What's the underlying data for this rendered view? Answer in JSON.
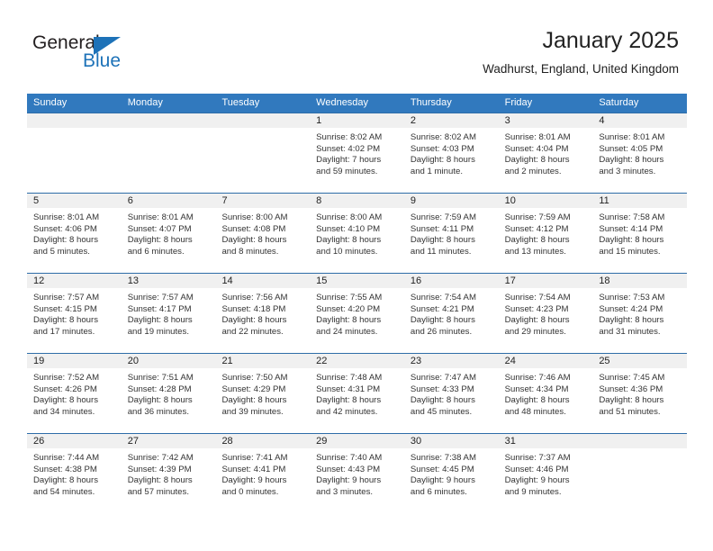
{
  "brand": {
    "name_part1": "General",
    "name_part2": "Blue",
    "logo_icon": "flag-triangle-icon",
    "accent_color": "#1d72b8"
  },
  "header": {
    "title": "January 2025",
    "subtitle": "Wadhurst, England, United Kingdom"
  },
  "theme": {
    "header_row_bg": "#3179be",
    "daynum_bg": "#f0f0f0",
    "grid_line": "#2e6da8"
  },
  "weekdays": [
    "Sunday",
    "Monday",
    "Tuesday",
    "Wednesday",
    "Thursday",
    "Friday",
    "Saturday"
  ],
  "weeks": [
    [
      {
        "day": "",
        "sunrise": "",
        "sunset": "",
        "daylight": "",
        "daylight2": ""
      },
      {
        "day": "",
        "sunrise": "",
        "sunset": "",
        "daylight": "",
        "daylight2": ""
      },
      {
        "day": "",
        "sunrise": "",
        "sunset": "",
        "daylight": "",
        "daylight2": ""
      },
      {
        "day": "1",
        "sunrise": "Sunrise: 8:02 AM",
        "sunset": "Sunset: 4:02 PM",
        "daylight": "Daylight: 7 hours",
        "daylight2": "and 59 minutes."
      },
      {
        "day": "2",
        "sunrise": "Sunrise: 8:02 AM",
        "sunset": "Sunset: 4:03 PM",
        "daylight": "Daylight: 8 hours",
        "daylight2": "and 1 minute."
      },
      {
        "day": "3",
        "sunrise": "Sunrise: 8:01 AM",
        "sunset": "Sunset: 4:04 PM",
        "daylight": "Daylight: 8 hours",
        "daylight2": "and 2 minutes."
      },
      {
        "day": "4",
        "sunrise": "Sunrise: 8:01 AM",
        "sunset": "Sunset: 4:05 PM",
        "daylight": "Daylight: 8 hours",
        "daylight2": "and 3 minutes."
      }
    ],
    [
      {
        "day": "5",
        "sunrise": "Sunrise: 8:01 AM",
        "sunset": "Sunset: 4:06 PM",
        "daylight": "Daylight: 8 hours",
        "daylight2": "and 5 minutes."
      },
      {
        "day": "6",
        "sunrise": "Sunrise: 8:01 AM",
        "sunset": "Sunset: 4:07 PM",
        "daylight": "Daylight: 8 hours",
        "daylight2": "and 6 minutes."
      },
      {
        "day": "7",
        "sunrise": "Sunrise: 8:00 AM",
        "sunset": "Sunset: 4:08 PM",
        "daylight": "Daylight: 8 hours",
        "daylight2": "and 8 minutes."
      },
      {
        "day": "8",
        "sunrise": "Sunrise: 8:00 AM",
        "sunset": "Sunset: 4:10 PM",
        "daylight": "Daylight: 8 hours",
        "daylight2": "and 10 minutes."
      },
      {
        "day": "9",
        "sunrise": "Sunrise: 7:59 AM",
        "sunset": "Sunset: 4:11 PM",
        "daylight": "Daylight: 8 hours",
        "daylight2": "and 11 minutes."
      },
      {
        "day": "10",
        "sunrise": "Sunrise: 7:59 AM",
        "sunset": "Sunset: 4:12 PM",
        "daylight": "Daylight: 8 hours",
        "daylight2": "and 13 minutes."
      },
      {
        "day": "11",
        "sunrise": "Sunrise: 7:58 AM",
        "sunset": "Sunset: 4:14 PM",
        "daylight": "Daylight: 8 hours",
        "daylight2": "and 15 minutes."
      }
    ],
    [
      {
        "day": "12",
        "sunrise": "Sunrise: 7:57 AM",
        "sunset": "Sunset: 4:15 PM",
        "daylight": "Daylight: 8 hours",
        "daylight2": "and 17 minutes."
      },
      {
        "day": "13",
        "sunrise": "Sunrise: 7:57 AM",
        "sunset": "Sunset: 4:17 PM",
        "daylight": "Daylight: 8 hours",
        "daylight2": "and 19 minutes."
      },
      {
        "day": "14",
        "sunrise": "Sunrise: 7:56 AM",
        "sunset": "Sunset: 4:18 PM",
        "daylight": "Daylight: 8 hours",
        "daylight2": "and 22 minutes."
      },
      {
        "day": "15",
        "sunrise": "Sunrise: 7:55 AM",
        "sunset": "Sunset: 4:20 PM",
        "daylight": "Daylight: 8 hours",
        "daylight2": "and 24 minutes."
      },
      {
        "day": "16",
        "sunrise": "Sunrise: 7:54 AM",
        "sunset": "Sunset: 4:21 PM",
        "daylight": "Daylight: 8 hours",
        "daylight2": "and 26 minutes."
      },
      {
        "day": "17",
        "sunrise": "Sunrise: 7:54 AM",
        "sunset": "Sunset: 4:23 PM",
        "daylight": "Daylight: 8 hours",
        "daylight2": "and 29 minutes."
      },
      {
        "day": "18",
        "sunrise": "Sunrise: 7:53 AM",
        "sunset": "Sunset: 4:24 PM",
        "daylight": "Daylight: 8 hours",
        "daylight2": "and 31 minutes."
      }
    ],
    [
      {
        "day": "19",
        "sunrise": "Sunrise: 7:52 AM",
        "sunset": "Sunset: 4:26 PM",
        "daylight": "Daylight: 8 hours",
        "daylight2": "and 34 minutes."
      },
      {
        "day": "20",
        "sunrise": "Sunrise: 7:51 AM",
        "sunset": "Sunset: 4:28 PM",
        "daylight": "Daylight: 8 hours",
        "daylight2": "and 36 minutes."
      },
      {
        "day": "21",
        "sunrise": "Sunrise: 7:50 AM",
        "sunset": "Sunset: 4:29 PM",
        "daylight": "Daylight: 8 hours",
        "daylight2": "and 39 minutes."
      },
      {
        "day": "22",
        "sunrise": "Sunrise: 7:48 AM",
        "sunset": "Sunset: 4:31 PM",
        "daylight": "Daylight: 8 hours",
        "daylight2": "and 42 minutes."
      },
      {
        "day": "23",
        "sunrise": "Sunrise: 7:47 AM",
        "sunset": "Sunset: 4:33 PM",
        "daylight": "Daylight: 8 hours",
        "daylight2": "and 45 minutes."
      },
      {
        "day": "24",
        "sunrise": "Sunrise: 7:46 AM",
        "sunset": "Sunset: 4:34 PM",
        "daylight": "Daylight: 8 hours",
        "daylight2": "and 48 minutes."
      },
      {
        "day": "25",
        "sunrise": "Sunrise: 7:45 AM",
        "sunset": "Sunset: 4:36 PM",
        "daylight": "Daylight: 8 hours",
        "daylight2": "and 51 minutes."
      }
    ],
    [
      {
        "day": "26",
        "sunrise": "Sunrise: 7:44 AM",
        "sunset": "Sunset: 4:38 PM",
        "daylight": "Daylight: 8 hours",
        "daylight2": "and 54 minutes."
      },
      {
        "day": "27",
        "sunrise": "Sunrise: 7:42 AM",
        "sunset": "Sunset: 4:39 PM",
        "daylight": "Daylight: 8 hours",
        "daylight2": "and 57 minutes."
      },
      {
        "day": "28",
        "sunrise": "Sunrise: 7:41 AM",
        "sunset": "Sunset: 4:41 PM",
        "daylight": "Daylight: 9 hours",
        "daylight2": "and 0 minutes."
      },
      {
        "day": "29",
        "sunrise": "Sunrise: 7:40 AM",
        "sunset": "Sunset: 4:43 PM",
        "daylight": "Daylight: 9 hours",
        "daylight2": "and 3 minutes."
      },
      {
        "day": "30",
        "sunrise": "Sunrise: 7:38 AM",
        "sunset": "Sunset: 4:45 PM",
        "daylight": "Daylight: 9 hours",
        "daylight2": "and 6 minutes."
      },
      {
        "day": "31",
        "sunrise": "Sunrise: 7:37 AM",
        "sunset": "Sunset: 4:46 PM",
        "daylight": "Daylight: 9 hours",
        "daylight2": "and 9 minutes."
      },
      {
        "day": "",
        "sunrise": "",
        "sunset": "",
        "daylight": "",
        "daylight2": ""
      }
    ]
  ]
}
